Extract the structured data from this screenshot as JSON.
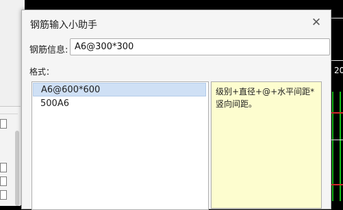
{
  "background": {
    "cad_label": "20"
  },
  "dialog": {
    "title": "钢筋输入小助手",
    "close_icon": "close-icon",
    "info": {
      "label": "钢筋信息:",
      "value": "A6@300*300"
    },
    "format": {
      "label": "格式：",
      "items": [
        {
          "label": "A6@600*600",
          "selected": true
        },
        {
          "label": "500A6",
          "selected": false
        }
      ],
      "description": "级别+直径+@+水平间距*竖向间距。"
    }
  },
  "colors": {
    "selected_item": "#cfe0f5",
    "description_bg": "#fdfdcf",
    "cad_green": "#17c41a",
    "cad_red": "#d22a2a"
  }
}
